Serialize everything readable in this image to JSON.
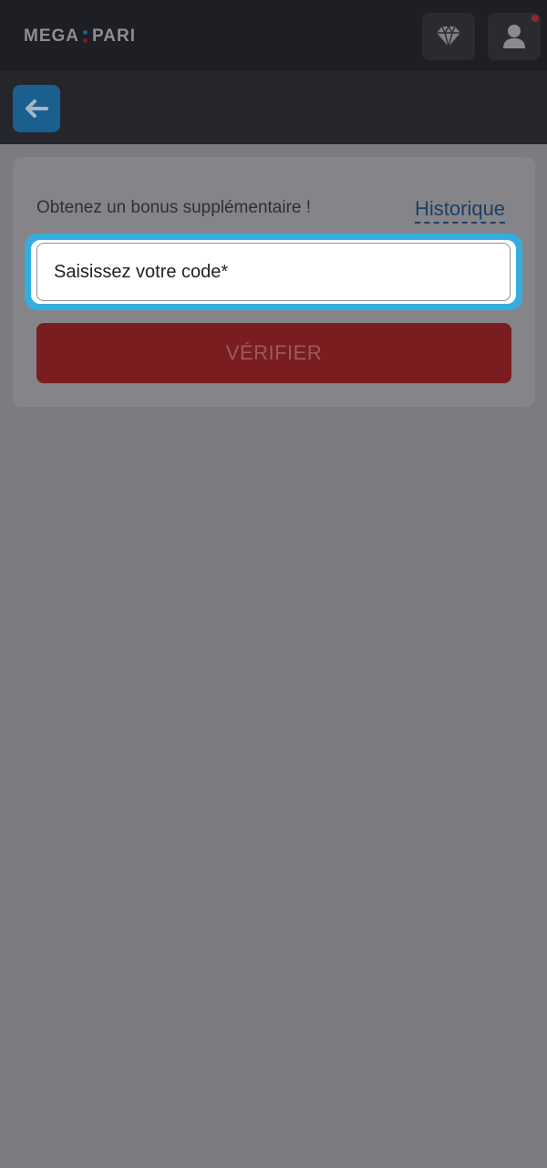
{
  "header": {
    "logo_left": "MEGA",
    "logo_right": "PARI"
  },
  "subheader": {
    "back_icon": "arrow-left-icon"
  },
  "promo": {
    "bonus_text": "Obtenez un bonus supplémentaire !",
    "history_link": "Historique",
    "code_placeholder": "Saisissez votre code*",
    "verify_button": "VÉRIFIER"
  },
  "colors": {
    "header_bg": "#1e1f25",
    "subheader_bg": "#25262c",
    "accent_blue": "#1b5f8e",
    "focus_ring": "#34aee0",
    "primary_red": "#7a1d20"
  }
}
